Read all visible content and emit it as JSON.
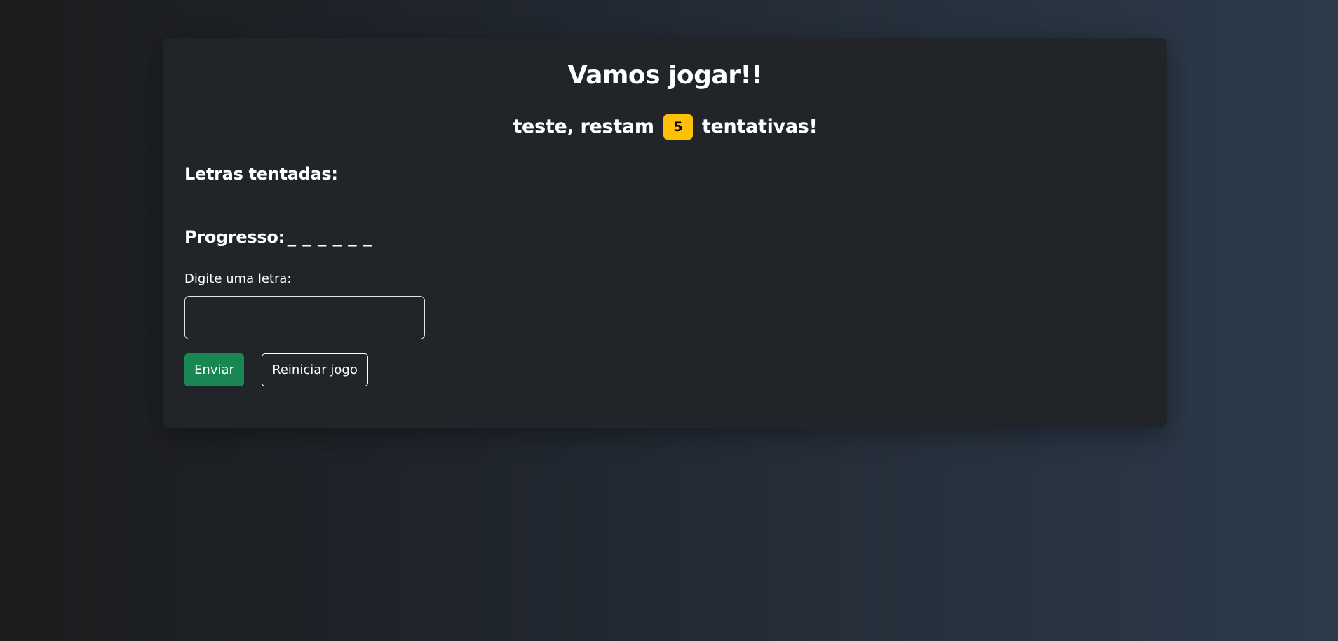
{
  "game": {
    "title": "Vamos jogar!!",
    "player_name": "teste",
    "attempts_prefix": ", restam",
    "attempts_remaining": "5",
    "attempts_suffix": "tentativas!",
    "tried_letters_label": "Letras tentadas:",
    "tried_letters": "",
    "progress_label": "Progresso:",
    "progress_value": "_ _ _ _ _ _",
    "input_label": "Digite uma letra:",
    "input_value": "",
    "input_placeholder": ""
  },
  "actions": {
    "send_label": "Enviar",
    "reset_label": "Reiniciar jogo"
  },
  "colors": {
    "badge": "#ffc107",
    "send_button": "#198754",
    "card_background": "#212529"
  }
}
